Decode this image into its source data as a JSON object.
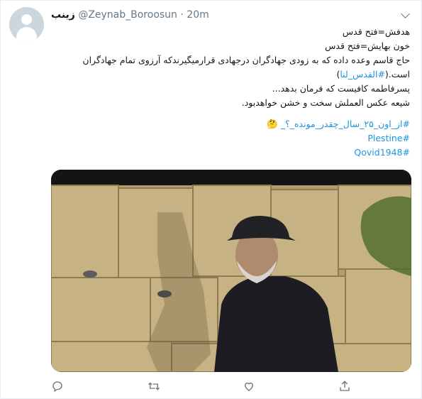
{
  "tweet": {
    "author_name": "زینب",
    "handle": "@Zeynab_Boroosun",
    "separator": "·",
    "time": "20m",
    "lines": [
      "هدفش=فتح قدس",
      "خون بهایش=فتح قدس",
      "حاج قاسم وعده داده که به زودی جهادگران درجهادی قرارمیگیرندکه آرزوی تمام جهادگران",
      "است.(",
      "#القدس_لنا",
      ")",
      "پسرفاطمه کافیست که فرمان بدهد...",
      "شیعه عکس العملش سخت و خشن خواهدبود."
    ],
    "hashtags": [
      "#از_اون_۲۵_سال_چقدر_مونده_؟_",
      "#Plestine",
      "#Qovid1948"
    ],
    "emoji": "🤔"
  },
  "icons": {
    "reply": "reply-icon",
    "retweet": "retweet-icon",
    "like": "like-icon",
    "share": "share-icon",
    "more": "chevron-down-icon"
  },
  "colors": {
    "link": "#1b95e0",
    "text": "#14171a",
    "muted": "#657786"
  }
}
